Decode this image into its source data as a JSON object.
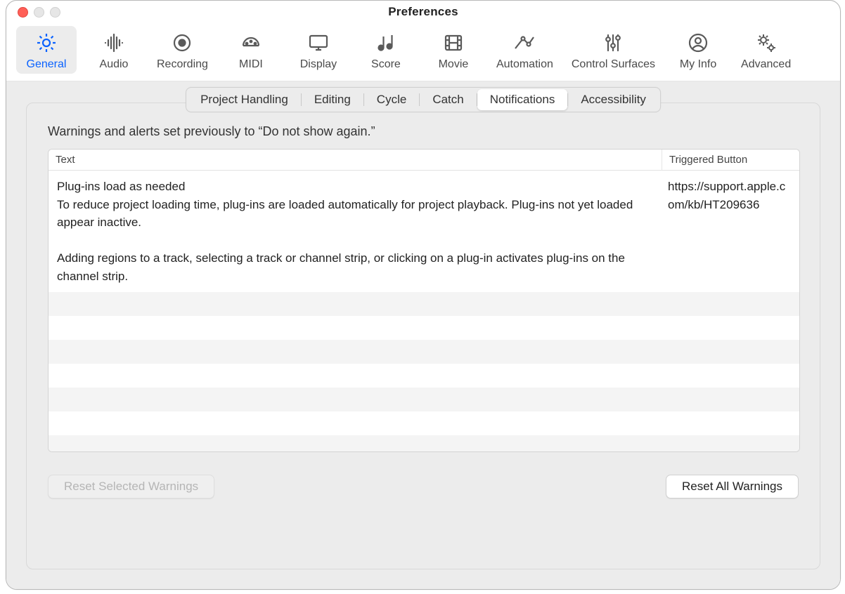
{
  "window": {
    "title": "Preferences"
  },
  "toolbar": {
    "items": [
      {
        "key": "general",
        "label": "General",
        "selected": true
      },
      {
        "key": "audio",
        "label": "Audio",
        "selected": false
      },
      {
        "key": "recording",
        "label": "Recording",
        "selected": false
      },
      {
        "key": "midi",
        "label": "MIDI",
        "selected": false
      },
      {
        "key": "display",
        "label": "Display",
        "selected": false
      },
      {
        "key": "score",
        "label": "Score",
        "selected": false
      },
      {
        "key": "movie",
        "label": "Movie",
        "selected": false
      },
      {
        "key": "automation",
        "label": "Automation",
        "selected": false
      },
      {
        "key": "control-surfaces",
        "label": "Control Surfaces",
        "selected": false
      },
      {
        "key": "my-info",
        "label": "My Info",
        "selected": false
      },
      {
        "key": "advanced",
        "label": "Advanced",
        "selected": false
      }
    ]
  },
  "subtabs": [
    {
      "key": "project-handling",
      "label": "Project Handling",
      "selected": false
    },
    {
      "key": "editing",
      "label": "Editing",
      "selected": false
    },
    {
      "key": "cycle",
      "label": "Cycle",
      "selected": false
    },
    {
      "key": "catch",
      "label": "Catch",
      "selected": false
    },
    {
      "key": "notifications",
      "label": "Notifications",
      "selected": true
    },
    {
      "key": "accessibility",
      "label": "Accessibility",
      "selected": false
    }
  ],
  "panel": {
    "description": "Warnings and alerts set previously to “Do not show again.”",
    "columns": {
      "text": "Text",
      "triggered": "Triggered Button"
    },
    "rows": [
      {
        "text": "Plug-ins load as needed\nTo reduce project loading time, plug-ins are loaded automatically for project playback. Plug-ins not yet loaded appear inactive.\n\nAdding regions to a track, selecting a track or channel strip, or clicking on a plug-in activates plug-ins on the channel strip.",
        "triggered": "https://support.apple.com/kb/HT209636"
      }
    ],
    "buttons": {
      "reset_selected": "Reset Selected Warnings",
      "reset_all": "Reset All Warnings"
    }
  }
}
